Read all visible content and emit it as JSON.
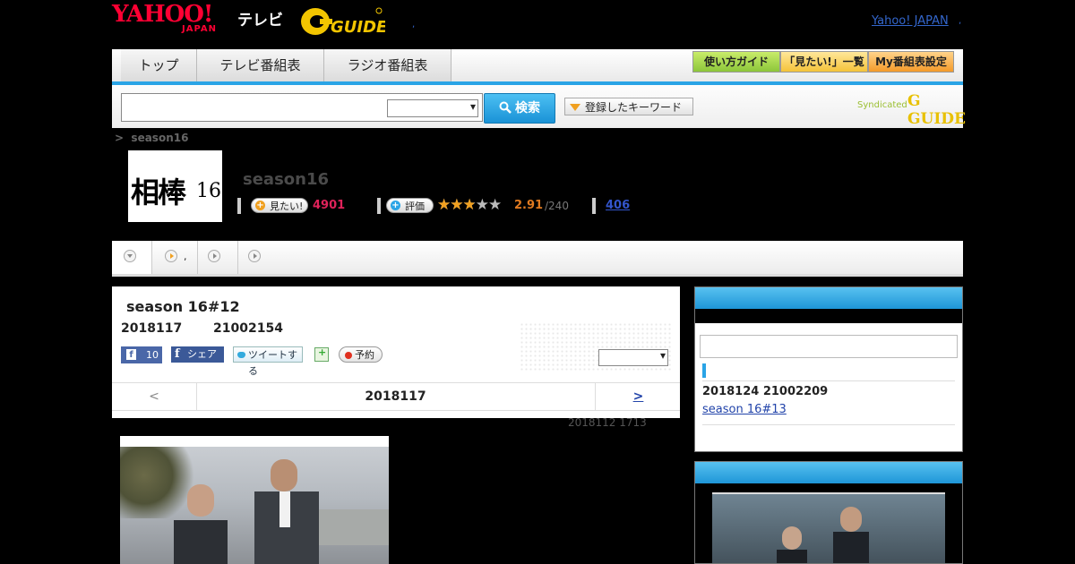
{
  "header": {
    "logo_yahoo": "YAHOO!",
    "logo_japan": "JAPAN",
    "logo_tv": "テレビ",
    "logo_gguide": "G GUIDE",
    "comma": ",",
    "yahoo_japan_link": "Yahoo! JAPAN",
    "link_comma": ","
  },
  "nav": {
    "tabs": [
      "トップ",
      "テレビ番組表",
      "ラジオ番組表"
    ],
    "right_buttons": [
      "使い方ガイド",
      "「見たい!」一覧",
      "My番組表設定"
    ]
  },
  "search": {
    "input_value": "",
    "select_value": "",
    "button_label": "検索",
    "keyword_button": "登録したキーワード",
    "syndicated_label": "Syndicated",
    "syndicated_logo": "G GUIDE"
  },
  "breadcrumb": {
    "separator": ">",
    "current": "season16"
  },
  "program": {
    "thumb_title": "相棒",
    "thumb_num": "16",
    "title": "season16",
    "mitai_label": "見たい!",
    "mitai_count": "4901",
    "rate_label": "評価",
    "stars_filled": 2.91,
    "stars_display": "★★★★★",
    "rating": "2.91",
    "rating_max": "/240",
    "reviews": "406"
  },
  "subtabs": {
    "tab2_comma": ","
  },
  "episode": {
    "title": "season 16#12",
    "date": "2018117",
    "time": "21002154",
    "fb_count": "10",
    "share_label": "シェア",
    "tweet_label": "ツイートする",
    "reserve_label": "予約",
    "select_value": "",
    "prev": "<",
    "current_date": "2018117",
    "next": ">",
    "updated": "2018112  1713"
  },
  "sidebar": {
    "next_datetime": "2018124  21002209",
    "next_episode_link": " season 16#13 "
  },
  "colors": {
    "accent_blue": "#2aa4e6",
    "mitai_pink": "#e0225a",
    "rating_orange": "#e07a20",
    "link_blue": "#2244aa"
  },
  "icons": {
    "search": "magnifier-icon",
    "dropdown": "chevron-down-icon",
    "play": "play-circle-icon",
    "facebook": "facebook-icon",
    "twitter": "twitter-bird-icon",
    "reserve": "record-dot-icon"
  }
}
